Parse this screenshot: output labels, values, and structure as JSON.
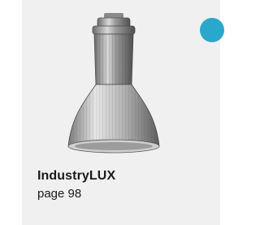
{
  "product": {
    "title": "IndustryLUX",
    "page_ref": "page 98",
    "image_icon": "industrial-highbay-lamp-icon"
  },
  "colors": {
    "accent_dot": "#2aa8cc",
    "card_bg": "#f0f0f0"
  }
}
